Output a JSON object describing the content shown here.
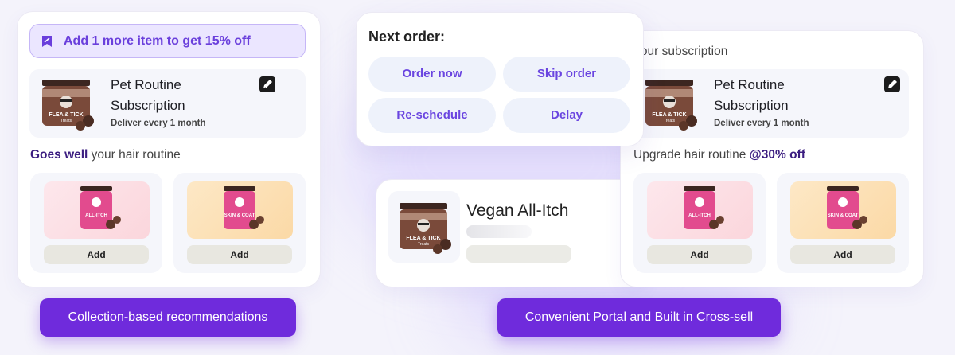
{
  "left_card": {
    "promo_text": "Add 1 more item to get 15% off",
    "product": {
      "title_line1": "Pet Routine",
      "title_line2": "Subscription",
      "subtitle": "Deliver every 1 month"
    },
    "section_bold": "Goes well",
    "section_rest": " your hair routine",
    "recommendations": [
      {
        "add_label": "Add"
      },
      {
        "add_label": "Add"
      }
    ]
  },
  "next_order": {
    "title": "Next order:",
    "buttons": [
      "Order now",
      "Skip order",
      "Re-schedule",
      "Delay"
    ]
  },
  "center_card": {
    "product_name": "Vegan All-Itch"
  },
  "right_card": {
    "header": "Your subscription",
    "product": {
      "title_line1": "Pet Routine",
      "title_line2": "Subscription",
      "subtitle": "Deliver every 1 month"
    },
    "section_rest": "Upgrade hair routine ",
    "section_bold": "@30% off",
    "recommendations": [
      {
        "add_label": "Add"
      },
      {
        "add_label": "Add"
      }
    ]
  },
  "footer": {
    "left_label": "Collection-based recommendations",
    "right_label": "Convenient Portal and Built in Cross-sell"
  },
  "jar_labels": {
    "main": "FLEA & TICK",
    "main_sub": "Treats",
    "pink": "ALL-ITCH",
    "orange": "SKIN & COAT"
  },
  "colors": {
    "accent": "#6f2bdc",
    "accent_text": "#6a45e0",
    "deep_purple": "#3b1d80"
  }
}
